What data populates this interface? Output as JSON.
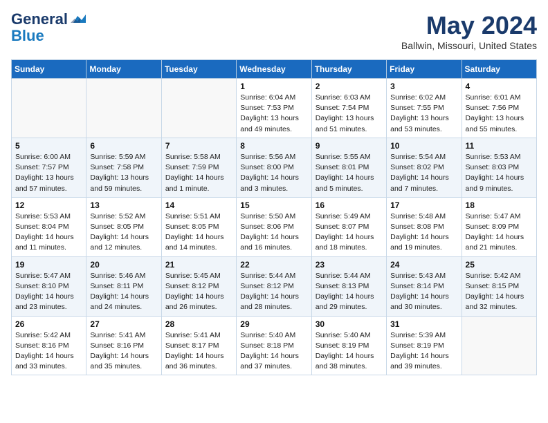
{
  "logo": {
    "line1": "General",
    "line2": "Blue"
  },
  "title": "May 2024",
  "location": "Ballwin, Missouri, United States",
  "days_header": [
    "Sunday",
    "Monday",
    "Tuesday",
    "Wednesday",
    "Thursday",
    "Friday",
    "Saturday"
  ],
  "weeks": [
    [
      {
        "day": "",
        "info": ""
      },
      {
        "day": "",
        "info": ""
      },
      {
        "day": "",
        "info": ""
      },
      {
        "day": "1",
        "info": "Sunrise: 6:04 AM\nSunset: 7:53 PM\nDaylight: 13 hours\nand 49 minutes."
      },
      {
        "day": "2",
        "info": "Sunrise: 6:03 AM\nSunset: 7:54 PM\nDaylight: 13 hours\nand 51 minutes."
      },
      {
        "day": "3",
        "info": "Sunrise: 6:02 AM\nSunset: 7:55 PM\nDaylight: 13 hours\nand 53 minutes."
      },
      {
        "day": "4",
        "info": "Sunrise: 6:01 AM\nSunset: 7:56 PM\nDaylight: 13 hours\nand 55 minutes."
      }
    ],
    [
      {
        "day": "5",
        "info": "Sunrise: 6:00 AM\nSunset: 7:57 PM\nDaylight: 13 hours\nand 57 minutes."
      },
      {
        "day": "6",
        "info": "Sunrise: 5:59 AM\nSunset: 7:58 PM\nDaylight: 13 hours\nand 59 minutes."
      },
      {
        "day": "7",
        "info": "Sunrise: 5:58 AM\nSunset: 7:59 PM\nDaylight: 14 hours\nand 1 minute."
      },
      {
        "day": "8",
        "info": "Sunrise: 5:56 AM\nSunset: 8:00 PM\nDaylight: 14 hours\nand 3 minutes."
      },
      {
        "day": "9",
        "info": "Sunrise: 5:55 AM\nSunset: 8:01 PM\nDaylight: 14 hours\nand 5 minutes."
      },
      {
        "day": "10",
        "info": "Sunrise: 5:54 AM\nSunset: 8:02 PM\nDaylight: 14 hours\nand 7 minutes."
      },
      {
        "day": "11",
        "info": "Sunrise: 5:53 AM\nSunset: 8:03 PM\nDaylight: 14 hours\nand 9 minutes."
      }
    ],
    [
      {
        "day": "12",
        "info": "Sunrise: 5:53 AM\nSunset: 8:04 PM\nDaylight: 14 hours\nand 11 minutes."
      },
      {
        "day": "13",
        "info": "Sunrise: 5:52 AM\nSunset: 8:05 PM\nDaylight: 14 hours\nand 12 minutes."
      },
      {
        "day": "14",
        "info": "Sunrise: 5:51 AM\nSunset: 8:05 PM\nDaylight: 14 hours\nand 14 minutes."
      },
      {
        "day": "15",
        "info": "Sunrise: 5:50 AM\nSunset: 8:06 PM\nDaylight: 14 hours\nand 16 minutes."
      },
      {
        "day": "16",
        "info": "Sunrise: 5:49 AM\nSunset: 8:07 PM\nDaylight: 14 hours\nand 18 minutes."
      },
      {
        "day": "17",
        "info": "Sunrise: 5:48 AM\nSunset: 8:08 PM\nDaylight: 14 hours\nand 19 minutes."
      },
      {
        "day": "18",
        "info": "Sunrise: 5:47 AM\nSunset: 8:09 PM\nDaylight: 14 hours\nand 21 minutes."
      }
    ],
    [
      {
        "day": "19",
        "info": "Sunrise: 5:47 AM\nSunset: 8:10 PM\nDaylight: 14 hours\nand 23 minutes."
      },
      {
        "day": "20",
        "info": "Sunrise: 5:46 AM\nSunset: 8:11 PM\nDaylight: 14 hours\nand 24 minutes."
      },
      {
        "day": "21",
        "info": "Sunrise: 5:45 AM\nSunset: 8:12 PM\nDaylight: 14 hours\nand 26 minutes."
      },
      {
        "day": "22",
        "info": "Sunrise: 5:44 AM\nSunset: 8:12 PM\nDaylight: 14 hours\nand 28 minutes."
      },
      {
        "day": "23",
        "info": "Sunrise: 5:44 AM\nSunset: 8:13 PM\nDaylight: 14 hours\nand 29 minutes."
      },
      {
        "day": "24",
        "info": "Sunrise: 5:43 AM\nSunset: 8:14 PM\nDaylight: 14 hours\nand 30 minutes."
      },
      {
        "day": "25",
        "info": "Sunrise: 5:42 AM\nSunset: 8:15 PM\nDaylight: 14 hours\nand 32 minutes."
      }
    ],
    [
      {
        "day": "26",
        "info": "Sunrise: 5:42 AM\nSunset: 8:16 PM\nDaylight: 14 hours\nand 33 minutes."
      },
      {
        "day": "27",
        "info": "Sunrise: 5:41 AM\nSunset: 8:16 PM\nDaylight: 14 hours\nand 35 minutes."
      },
      {
        "day": "28",
        "info": "Sunrise: 5:41 AM\nSunset: 8:17 PM\nDaylight: 14 hours\nand 36 minutes."
      },
      {
        "day": "29",
        "info": "Sunrise: 5:40 AM\nSunset: 8:18 PM\nDaylight: 14 hours\nand 37 minutes."
      },
      {
        "day": "30",
        "info": "Sunrise: 5:40 AM\nSunset: 8:19 PM\nDaylight: 14 hours\nand 38 minutes."
      },
      {
        "day": "31",
        "info": "Sunrise: 5:39 AM\nSunset: 8:19 PM\nDaylight: 14 hours\nand 39 minutes."
      },
      {
        "day": "",
        "info": ""
      }
    ]
  ]
}
